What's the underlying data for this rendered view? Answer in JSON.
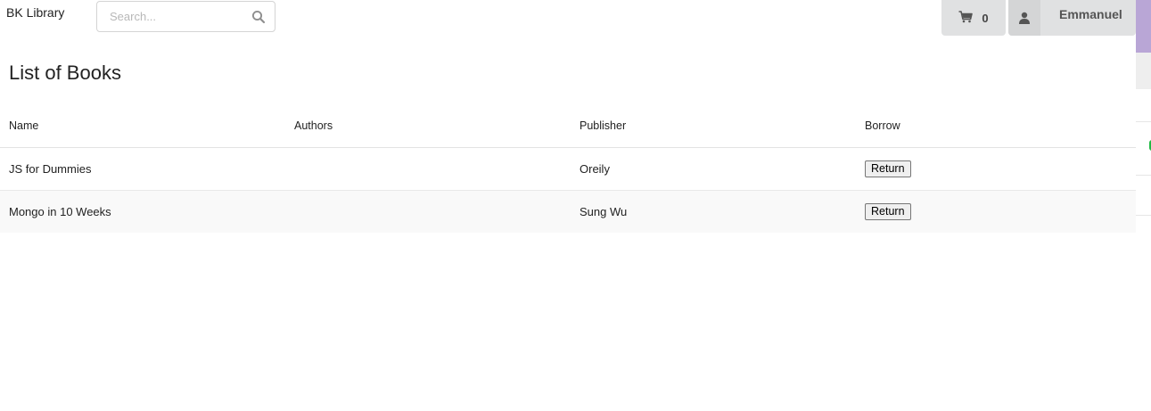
{
  "header": {
    "brand": "BK Library",
    "search_placeholder": "Search...",
    "cart_count": "0",
    "user_name": "Emmanuel"
  },
  "main": {
    "title": "List of Books",
    "columns": [
      "Name",
      "Authors",
      "Publisher",
      "Borrow"
    ],
    "rows": [
      {
        "name": "JS for Dummies",
        "authors": "",
        "publisher": "Oreily",
        "action": "Return"
      },
      {
        "name": "Mongo in 10 Weeks",
        "authors": "",
        "publisher": "Sung Wu",
        "action": "Return"
      }
    ]
  },
  "icons": {
    "search": "search-icon",
    "cart": "cart-icon",
    "user": "user-icon"
  },
  "colors": {
    "button_bg": "#e0e1e2",
    "row_stripe": "#f9f9f9",
    "accent_purple": "#b9a6d6"
  }
}
